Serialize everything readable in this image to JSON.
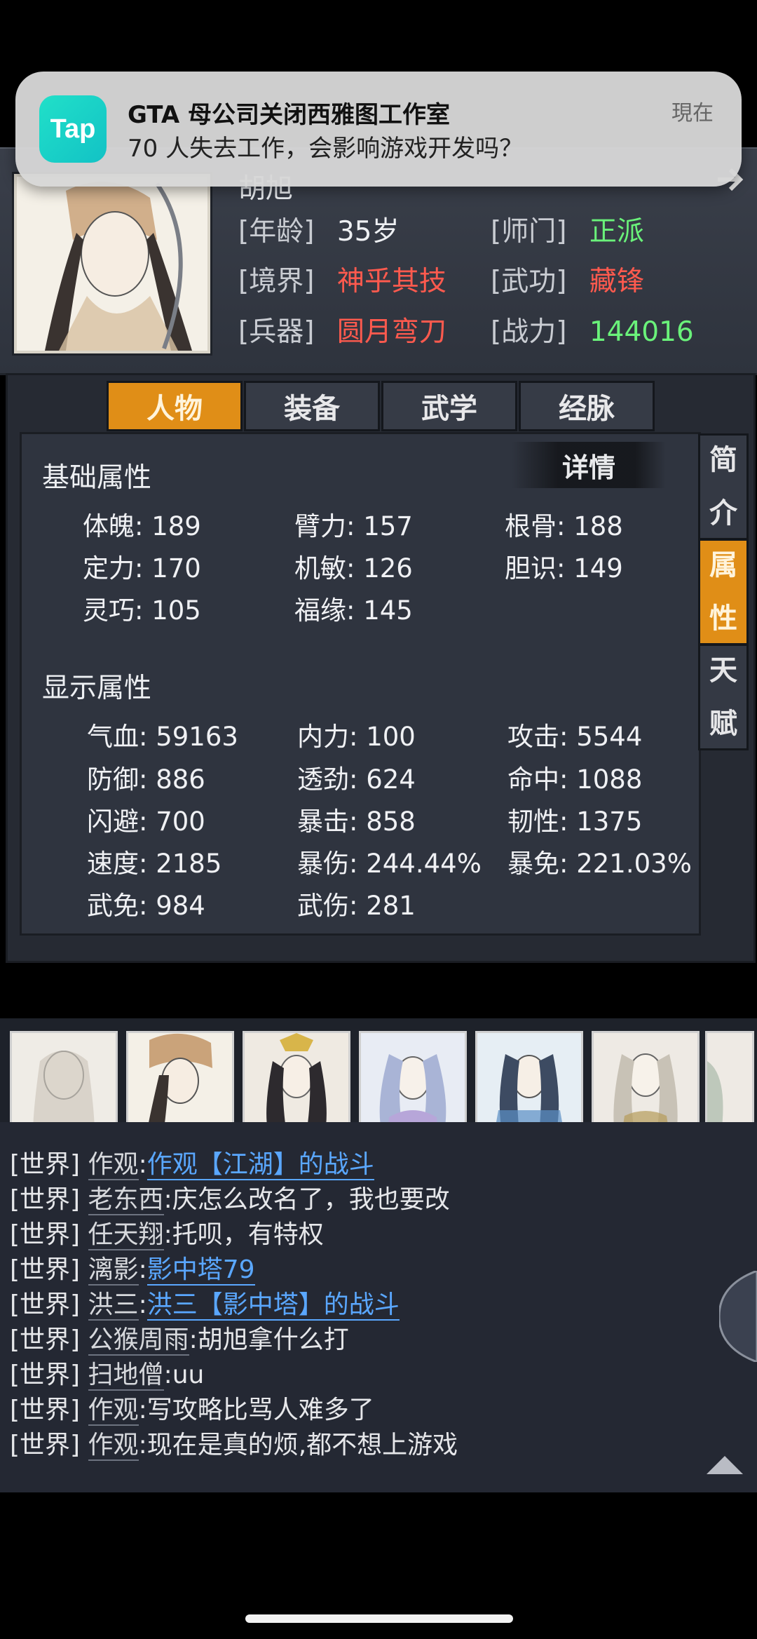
{
  "notification": {
    "app_icon_text": "Tap",
    "title": "GTA 母公司关闭西雅图工作室",
    "body": "70 人失去工作，会影响游戏开发吗？",
    "time": "現在"
  },
  "profile": {
    "name_partial": "胡旭",
    "age_label": "[年龄]",
    "age": "35岁",
    "sect_label": "[师门]",
    "sect": "正派",
    "realm_label": "[境界]",
    "realm": "神乎其技",
    "skill_label": "[武功]",
    "skill": "藏锋",
    "weapon_label": "[兵器]",
    "weapon": "圆月弯刀",
    "power_label": "[战力]",
    "power": "144016"
  },
  "tabs": [
    "人物",
    "装备",
    "武学",
    "经脉"
  ],
  "side_tabs": [
    {
      "label": "简介",
      "chars": [
        "简",
        "介"
      ]
    },
    {
      "label": "属性",
      "chars": [
        "属",
        "性"
      ]
    },
    {
      "label": "天赋",
      "chars": [
        "天",
        "赋"
      ]
    }
  ],
  "detail_button": "详情",
  "basic": {
    "title": "基础属性",
    "stats": [
      "体魄: 189",
      "臂力: 157",
      "根骨: 188",
      "定力: 170",
      "机敏: 126",
      "胆识: 149",
      "灵巧: 105",
      "福缘: 145"
    ]
  },
  "display": {
    "title": "显示属性",
    "stats": [
      "气血: 59163",
      "内力: 100",
      "攻击: 5544",
      "防御: 886",
      "透劲: 624",
      "命中: 1088",
      "闪避: 700",
      "暴击: 858",
      "韧性: 1375",
      "速度: 2185",
      "暴伤: 244.44%",
      "暴免: 221.03%",
      "武免: 984",
      "武伤: 281"
    ]
  },
  "chat": [
    {
      "tag": "[世界]",
      "name": "作观",
      "sep": ":",
      "text": "作观【江湖】的战斗",
      "link": true
    },
    {
      "tag": "[世界]",
      "name": "老东西",
      "sep": ":",
      "text": "庆怎么改名了，我也要改",
      "link": false
    },
    {
      "tag": "[世界]",
      "name": "任天翔",
      "sep": ":",
      "text": "托呗，有特权",
      "link": false
    },
    {
      "tag": "[世界]",
      "name": "漓影",
      "sep": ":",
      "text": "影中塔79",
      "link": true
    },
    {
      "tag": "[世界]",
      "name": "洪三",
      "sep": ":",
      "text": "洪三【影中塔】的战斗",
      "link": true
    },
    {
      "tag": "[世界]",
      "name": "公猴周雨",
      "sep": ":",
      "text": "胡旭拿什么打",
      "link": false
    },
    {
      "tag": "[世界]",
      "name": "扫地僧",
      "sep": ":",
      "text": "uu",
      "link": false
    },
    {
      "tag": "[世界]",
      "name": "作观",
      "sep": ":",
      "text": "写攻略比骂人难多了",
      "link": false
    },
    {
      "tag": "[世界]",
      "name": "作观",
      "sep": ":",
      "text": "现在是真的烦,都不想上游戏",
      "link": false
    }
  ],
  "colors": {
    "accent_orange": "#e08e17",
    "link_blue": "#5aa7ff",
    "red": "#ff5a4e",
    "green": "#6af27a"
  }
}
